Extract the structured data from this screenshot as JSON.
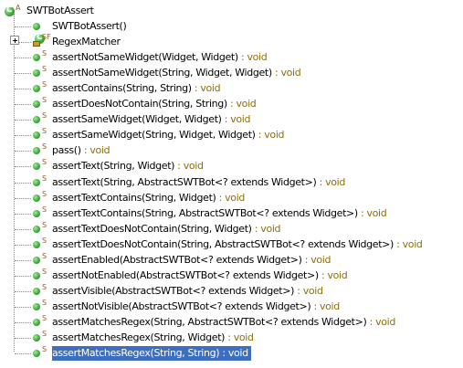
{
  "tree": {
    "root": {
      "name": "SWTBotAssert",
      "icon": "class-icon",
      "modifier": "A"
    },
    "constructor": {
      "name": "SWTBotAssert()",
      "icon": "constructor-icon"
    },
    "inner_class": {
      "name": "RegexMatcher",
      "icon": "inner-class-icon",
      "modifier": "SF"
    },
    "methods": [
      {
        "signature": "assertNotSameWidget(Widget, Widget)",
        "return_type": " : void",
        "modifier": "S"
      },
      {
        "signature": "assertNotSameWidget(String, Widget, Widget)",
        "return_type": " : void",
        "modifier": "S"
      },
      {
        "signature": "assertContains(String, String)",
        "return_type": " : void",
        "modifier": "S"
      },
      {
        "signature": "assertDoesNotContain(String, String)",
        "return_type": " : void",
        "modifier": "S"
      },
      {
        "signature": "assertSameWidget(Widget, Widget)",
        "return_type": " : void",
        "modifier": "S"
      },
      {
        "signature": "assertSameWidget(String, Widget, Widget)",
        "return_type": " : void",
        "modifier": "S"
      },
      {
        "signature": "pass()",
        "return_type": " : void",
        "modifier": "S"
      },
      {
        "signature": "assertText(String, Widget)",
        "return_type": " : void",
        "modifier": "S"
      },
      {
        "signature": "assertText(String, AbstractSWTBot<? extends Widget>)",
        "return_type": " : void",
        "modifier": "S"
      },
      {
        "signature": "assertTextContains(String, Widget)",
        "return_type": " : void",
        "modifier": "S"
      },
      {
        "signature": "assertTextContains(String, AbstractSWTBot<? extends Widget>)",
        "return_type": " : void",
        "modifier": "S"
      },
      {
        "signature": "assertTextDoesNotContain(String, Widget)",
        "return_type": " : void",
        "modifier": "S"
      },
      {
        "signature": "assertTextDoesNotContain(String, AbstractSWTBot<? extends Widget>)",
        "return_type": " : void",
        "modifier": "S"
      },
      {
        "signature": "assertEnabled(AbstractSWTBot<? extends Widget>)",
        "return_type": " : void",
        "modifier": "S"
      },
      {
        "signature": "assertNotEnabled(AbstractSWTBot<? extends Widget>)",
        "return_type": " : void",
        "modifier": "S"
      },
      {
        "signature": "assertVisible(AbstractSWTBot<? extends Widget>)",
        "return_type": " : void",
        "modifier": "S"
      },
      {
        "signature": "assertNotVisible(AbstractSWTBot<? extends Widget>)",
        "return_type": " : void",
        "modifier": "S"
      },
      {
        "signature": "assertMatchesRegex(String, AbstractSWTBot<? extends Widget>)",
        "return_type": " : void",
        "modifier": "S"
      },
      {
        "signature": "assertMatchesRegex(String, Widget)",
        "return_type": " : void",
        "modifier": "S"
      },
      {
        "signature": "assertMatchesRegex(String, String)",
        "return_type": " : void",
        "modifier": "S",
        "selected": true
      }
    ],
    "colors": {
      "return_type": "#8f6e08",
      "selection": "#3d6ebf",
      "method_icon": "#3fae3c"
    }
  }
}
